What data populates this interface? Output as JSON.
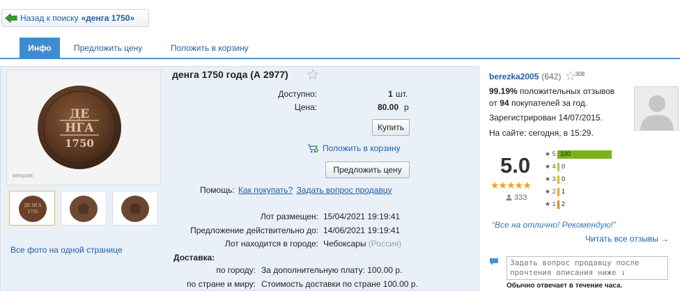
{
  "nav": {
    "back_label": "Назад к поиску",
    "search_query": "«денга 1750»"
  },
  "tabs": [
    {
      "label": "Инфо",
      "active": true
    },
    {
      "label": "Предложить цену",
      "active": false
    },
    {
      "label": "Положить в корзину",
      "active": false
    }
  ],
  "lot": {
    "title": "денга 1750 года (А 2977)",
    "available_label": "Доступно:",
    "available_qty": "1",
    "available_unit": "шт.",
    "price_label": "Цена:",
    "price_value": "80.00",
    "price_currency": "р",
    "buy_button": "Купить",
    "cart_link": "Положить в корзину",
    "offer_button": "Предложить цену",
    "help_label": "Помощь:",
    "help_how_to_buy": "Как покупать?",
    "help_ask_seller": "Задать вопрос продавцу",
    "photo_watermark": "мешок",
    "all_photos_link": "Все фото на одной странице",
    "info": [
      {
        "label": "Лот размещен:",
        "value": "15/04/2021 19:19:41"
      },
      {
        "label": "Предложение действительно до:",
        "value": "14/06/2021 19:19:41"
      },
      {
        "label": "Лот находится в городе:",
        "value": "Чебоксары",
        "extra": "(Россия)"
      }
    ],
    "delivery_title": "Доставка:",
    "delivery": [
      {
        "label": "по городу:",
        "value": "За дополнительную плату: 100.00 р."
      },
      {
        "label": "по стране и миру:",
        "value": "Стоимость доставки по стране 100.00 р."
      }
    ]
  },
  "seller": {
    "name": "berezka2005",
    "count": "(642)",
    "star_count": "308",
    "positive_percent": "99.19%",
    "positive_text": "положительных отзывов",
    "from_label": "от",
    "buyers_count": "94",
    "buyers_text": "покупателей за год.",
    "registered": "Зарегистрирован 14/07/2015.",
    "online": "На сайте: сегодня, в 15:29.",
    "score": "5.0",
    "review_count": "333",
    "ratings": [
      {
        "stars": "5",
        "count": "330",
        "fraction": 1.0,
        "color": "#7ab317"
      },
      {
        "stars": "4",
        "count": "0",
        "fraction": 0.0,
        "color": "#a9c53a"
      },
      {
        "stars": "3",
        "count": "0",
        "fraction": 0.0,
        "color": "#d7c100"
      },
      {
        "stars": "2",
        "count": "1",
        "fraction": 0.003,
        "color": "#f0a31d"
      },
      {
        "stars": "1",
        "count": "2",
        "fraction": 0.006,
        "color": "#ef7a1a"
      }
    ],
    "last_review": "“Все на отлично! Рекомендую!”",
    "read_all": "Читать все отзывы →",
    "ask_placeholder": "Задать вопрос продавцу после прочтения описания ниже ↓",
    "reply_note": "Обычно отвечает в течение часа."
  },
  "colors": {
    "accent": "#3f8ad0",
    "link": "#1f5fa8",
    "panel_bg": "#eaf0f7",
    "star": "#f5a10f"
  }
}
